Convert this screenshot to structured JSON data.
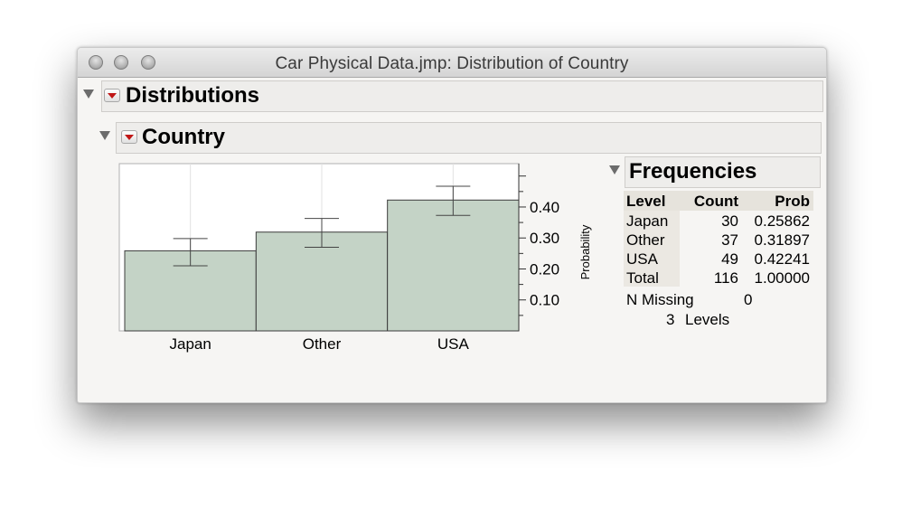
{
  "window": {
    "title": "Car Physical Data.jmp: Distribution of Country"
  },
  "outline": {
    "distributions_title": "Distributions",
    "country_title": "Country",
    "frequencies_title": "Frequencies"
  },
  "chart_data": {
    "type": "bar",
    "categories": [
      "Japan",
      "Other",
      "USA"
    ],
    "values": [
      0.25862,
      0.31897,
      0.42241
    ],
    "error_bars": [
      {
        "low": 0.21,
        "high": 0.298
      },
      {
        "low": 0.27,
        "high": 0.363
      },
      {
        "low": 0.373,
        "high": 0.467
      }
    ],
    "ylabel": "Probability",
    "yticks": [
      "0.10",
      "0.20",
      "0.30",
      "0.40"
    ],
    "ytick_values": [
      0.1,
      0.2,
      0.3,
      0.4
    ],
    "ylim": [
      0,
      0.54
    ],
    "bar_color": "#c4d3c6",
    "grid": true
  },
  "frequencies": {
    "headers": {
      "level": "Level",
      "count": "Count",
      "prob": "Prob"
    },
    "rows": [
      {
        "level": "Japan",
        "count": "30",
        "prob": "0.25862"
      },
      {
        "level": "Other",
        "count": "37",
        "prob": "0.31897"
      },
      {
        "level": "USA",
        "count": "49",
        "prob": "0.42241"
      },
      {
        "level": "Total",
        "count": "116",
        "prob": "1.00000"
      }
    ],
    "n_missing_label": "N Missing",
    "n_missing_value": "0",
    "levels_count": "3",
    "levels_label": "Levels"
  },
  "colors": {
    "menu_arrow": "#c01616",
    "header_bg": "#eeedeb",
    "window_bg": "#f6f5f3"
  }
}
